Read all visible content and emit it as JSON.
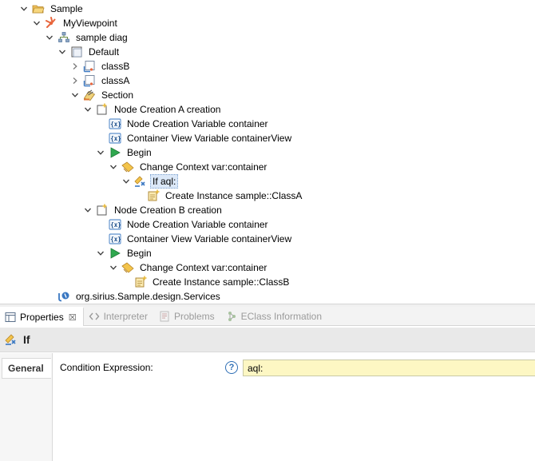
{
  "tree": {
    "rows": [
      {
        "id": "sample",
        "label": "Sample",
        "twisty": "open",
        "icon": "folder-icon"
      },
      {
        "id": "myviewpoint",
        "label": "MyViewpoint",
        "twisty": "open",
        "icon": "viewpoint-icon"
      },
      {
        "id": "sample-diag",
        "label": "sample diag",
        "twisty": "open",
        "icon": "diagram-icon"
      },
      {
        "id": "default",
        "label": "Default",
        "twisty": "open",
        "icon": "layer-icon"
      },
      {
        "id": "classB",
        "label": "classB",
        "twisty": "closed",
        "icon": "node-mapping-icon"
      },
      {
        "id": "classA",
        "label": "classA",
        "twisty": "closed",
        "icon": "node-mapping-icon"
      },
      {
        "id": "section",
        "label": "Section",
        "twisty": "open",
        "icon": "section-icon"
      },
      {
        "id": "nca",
        "label": "Node Creation A creation",
        "twisty": "open",
        "icon": "node-creation-icon"
      },
      {
        "id": "nca-var",
        "label": "Node Creation Variable container",
        "twisty": "none",
        "icon": "variable-icon"
      },
      {
        "id": "nca-cvv",
        "label": "Container View Variable containerView",
        "twisty": "none",
        "icon": "variable-icon"
      },
      {
        "id": "nca-begin",
        "label": "Begin",
        "twisty": "open",
        "icon": "begin-icon"
      },
      {
        "id": "nca-cc",
        "label": "Change Context var:container",
        "twisty": "open",
        "icon": "change-context-icon"
      },
      {
        "id": "nca-if",
        "label": "If aql:",
        "twisty": "open",
        "icon": "if-icon",
        "selected": true
      },
      {
        "id": "nca-ci",
        "label": "Create Instance sample::ClassA",
        "twisty": "none",
        "icon": "create-instance-icon"
      },
      {
        "id": "ncb",
        "label": "Node Creation B creation",
        "twisty": "open",
        "icon": "node-creation-icon"
      },
      {
        "id": "ncb-var",
        "label": "Node Creation Variable container",
        "twisty": "none",
        "icon": "variable-icon"
      },
      {
        "id": "ncb-cvv",
        "label": "Container View Variable containerView",
        "twisty": "none",
        "icon": "variable-icon"
      },
      {
        "id": "ncb-begin",
        "label": "Begin",
        "twisty": "open",
        "icon": "begin-icon"
      },
      {
        "id": "ncb-cc",
        "label": "Change Context var:container",
        "twisty": "open",
        "icon": "change-context-icon"
      },
      {
        "id": "ncb-ci",
        "label": "Create Instance sample::ClassB",
        "twisty": "none",
        "icon": "create-instance-icon"
      },
      {
        "id": "services",
        "label": "org.sirius.Sample.design.Services",
        "twisty": "none",
        "icon": "java-extension-icon"
      }
    ]
  },
  "views": {
    "tabs": [
      {
        "label": "Properties",
        "icon": "properties-icon",
        "active": true,
        "close": "☒"
      },
      {
        "label": "Interpreter",
        "icon": "interpreter-icon",
        "active": false
      },
      {
        "label": "Problems",
        "icon": "problems-icon",
        "active": false
      },
      {
        "label": "EClass Information",
        "icon": "eclass-info-icon",
        "active": false
      }
    ]
  },
  "properties": {
    "title": "If",
    "title_icon": "if-icon",
    "side_tab": "General",
    "field_label": "Condition Expression:",
    "help": "?",
    "field_value": "aql:"
  },
  "colors": {
    "selection": "#dbe8f8",
    "expression_field": "#fdf7c3",
    "begin_green": "#2fa84f",
    "folder_yellow": "#f0c05a",
    "viewpoint_orange": "#e8663d"
  }
}
